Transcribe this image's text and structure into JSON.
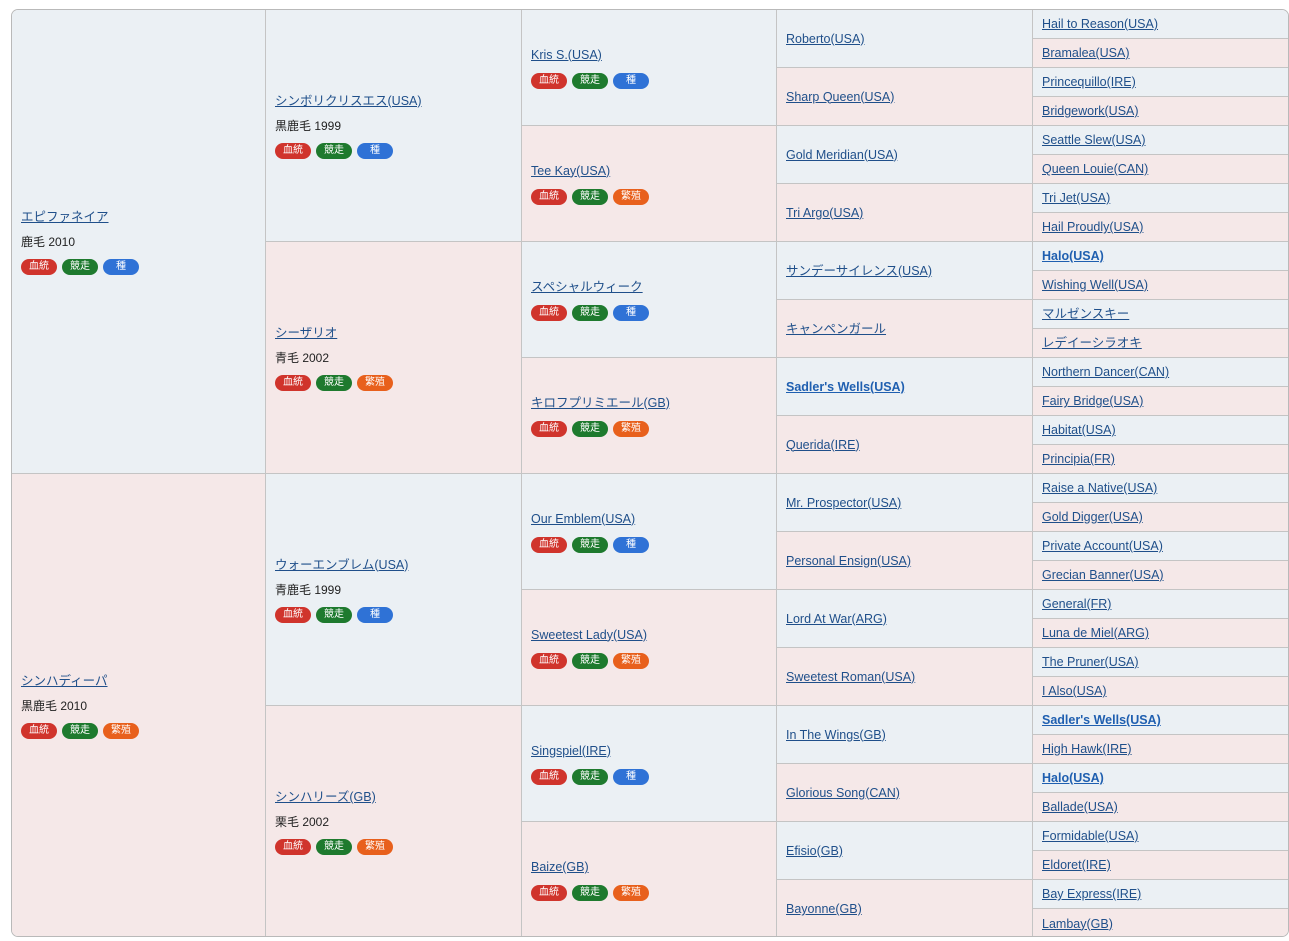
{
  "badge_labels": {
    "pedigree": "血統",
    "racing": "競走",
    "stallion": "種",
    "breeding": "繁殖"
  },
  "colors": {
    "male_bg": "#ebf0f4",
    "female_bg": "#f5e8e8",
    "badge_pedigree": "#d0342c",
    "badge_racing": "#1e7a2e",
    "badge_stallion": "#2f72d6",
    "badge_breeding": "#e8601c",
    "link": "#1f4f8a"
  },
  "gen1": [
    {
      "name": "エピファネイア",
      "info": "鹿毛 2010",
      "role": "stallion"
    },
    {
      "name": "シンハディーパ",
      "info": "黒鹿毛 2010",
      "role": "breeding"
    }
  ],
  "gen2": [
    {
      "name": "シンボリクリスエス(USA)",
      "info": "黒鹿毛 1999",
      "role": "stallion"
    },
    {
      "name": "シーザリオ",
      "info": "青毛 2002",
      "role": "breeding"
    },
    {
      "name": "ウォーエンブレム(USA)",
      "info": "青鹿毛 1999",
      "role": "stallion"
    },
    {
      "name": "シンハリーズ(GB)",
      "info": "栗毛 2002",
      "role": "breeding"
    }
  ],
  "gen3": [
    {
      "name": "Kris S.(USA)",
      "role": "stallion"
    },
    {
      "name": "Tee Kay(USA)",
      "role": "breeding"
    },
    {
      "name": "スペシャルウィーク",
      "role": "stallion"
    },
    {
      "name": "キロフプリミエール(GB)",
      "role": "breeding"
    },
    {
      "name": "Our Emblem(USA)",
      "role": "stallion"
    },
    {
      "name": "Sweetest Lady(USA)",
      "role": "breeding"
    },
    {
      "name": "Singspiel(IRE)",
      "role": "stallion"
    },
    {
      "name": "Baize(GB)",
      "role": "breeding"
    }
  ],
  "gen4": [
    {
      "name": "Roberto(USA)"
    },
    {
      "name": "Sharp Queen(USA)"
    },
    {
      "name": "Gold Meridian(USA)"
    },
    {
      "name": "Tri Argo(USA)"
    },
    {
      "name": "サンデーサイレンス(USA)"
    },
    {
      "name": "キャンペンガール"
    },
    {
      "name": "Sadler's Wells(USA)",
      "bold": true
    },
    {
      "name": "Querida(IRE)"
    },
    {
      "name": "Mr. Prospector(USA)"
    },
    {
      "name": "Personal Ensign(USA)"
    },
    {
      "name": "Lord At War(ARG)"
    },
    {
      "name": "Sweetest Roman(USA)"
    },
    {
      "name": "In The Wings(GB)"
    },
    {
      "name": "Glorious Song(CAN)"
    },
    {
      "name": "Efisio(GB)"
    },
    {
      "name": "Bayonne(GB)"
    }
  ],
  "gen5": [
    {
      "name": "Hail to Reason(USA)"
    },
    {
      "name": "Bramalea(USA)"
    },
    {
      "name": "Princequillo(IRE)"
    },
    {
      "name": "Bridgework(USA)"
    },
    {
      "name": "Seattle Slew(USA)"
    },
    {
      "name": "Queen Louie(CAN)"
    },
    {
      "name": "Tri Jet(USA)"
    },
    {
      "name": "Hail Proudly(USA)"
    },
    {
      "name": "Halo(USA)",
      "bold": true
    },
    {
      "name": "Wishing Well(USA)"
    },
    {
      "name": "マルゼンスキー"
    },
    {
      "name": "レデイーシラオキ"
    },
    {
      "name": "Northern Dancer(CAN)"
    },
    {
      "name": "Fairy Bridge(USA)"
    },
    {
      "name": "Habitat(USA)"
    },
    {
      "name": "Principia(FR)"
    },
    {
      "name": "Raise a Native(USA)"
    },
    {
      "name": "Gold Digger(USA)"
    },
    {
      "name": "Private Account(USA)"
    },
    {
      "name": "Grecian Banner(USA)"
    },
    {
      "name": "General(FR)"
    },
    {
      "name": "Luna de Miel(ARG)"
    },
    {
      "name": "The Pruner(USA)"
    },
    {
      "name": "I Also(USA)"
    },
    {
      "name": "Sadler's Wells(USA)",
      "bold": true
    },
    {
      "name": "High Hawk(IRE)"
    },
    {
      "name": "Halo(USA)",
      "bold": true
    },
    {
      "name": "Ballade(USA)"
    },
    {
      "name": "Formidable(USA)"
    },
    {
      "name": "Eldoret(IRE)"
    },
    {
      "name": "Bay Express(IRE)"
    },
    {
      "name": "Lambay(GB)"
    }
  ]
}
